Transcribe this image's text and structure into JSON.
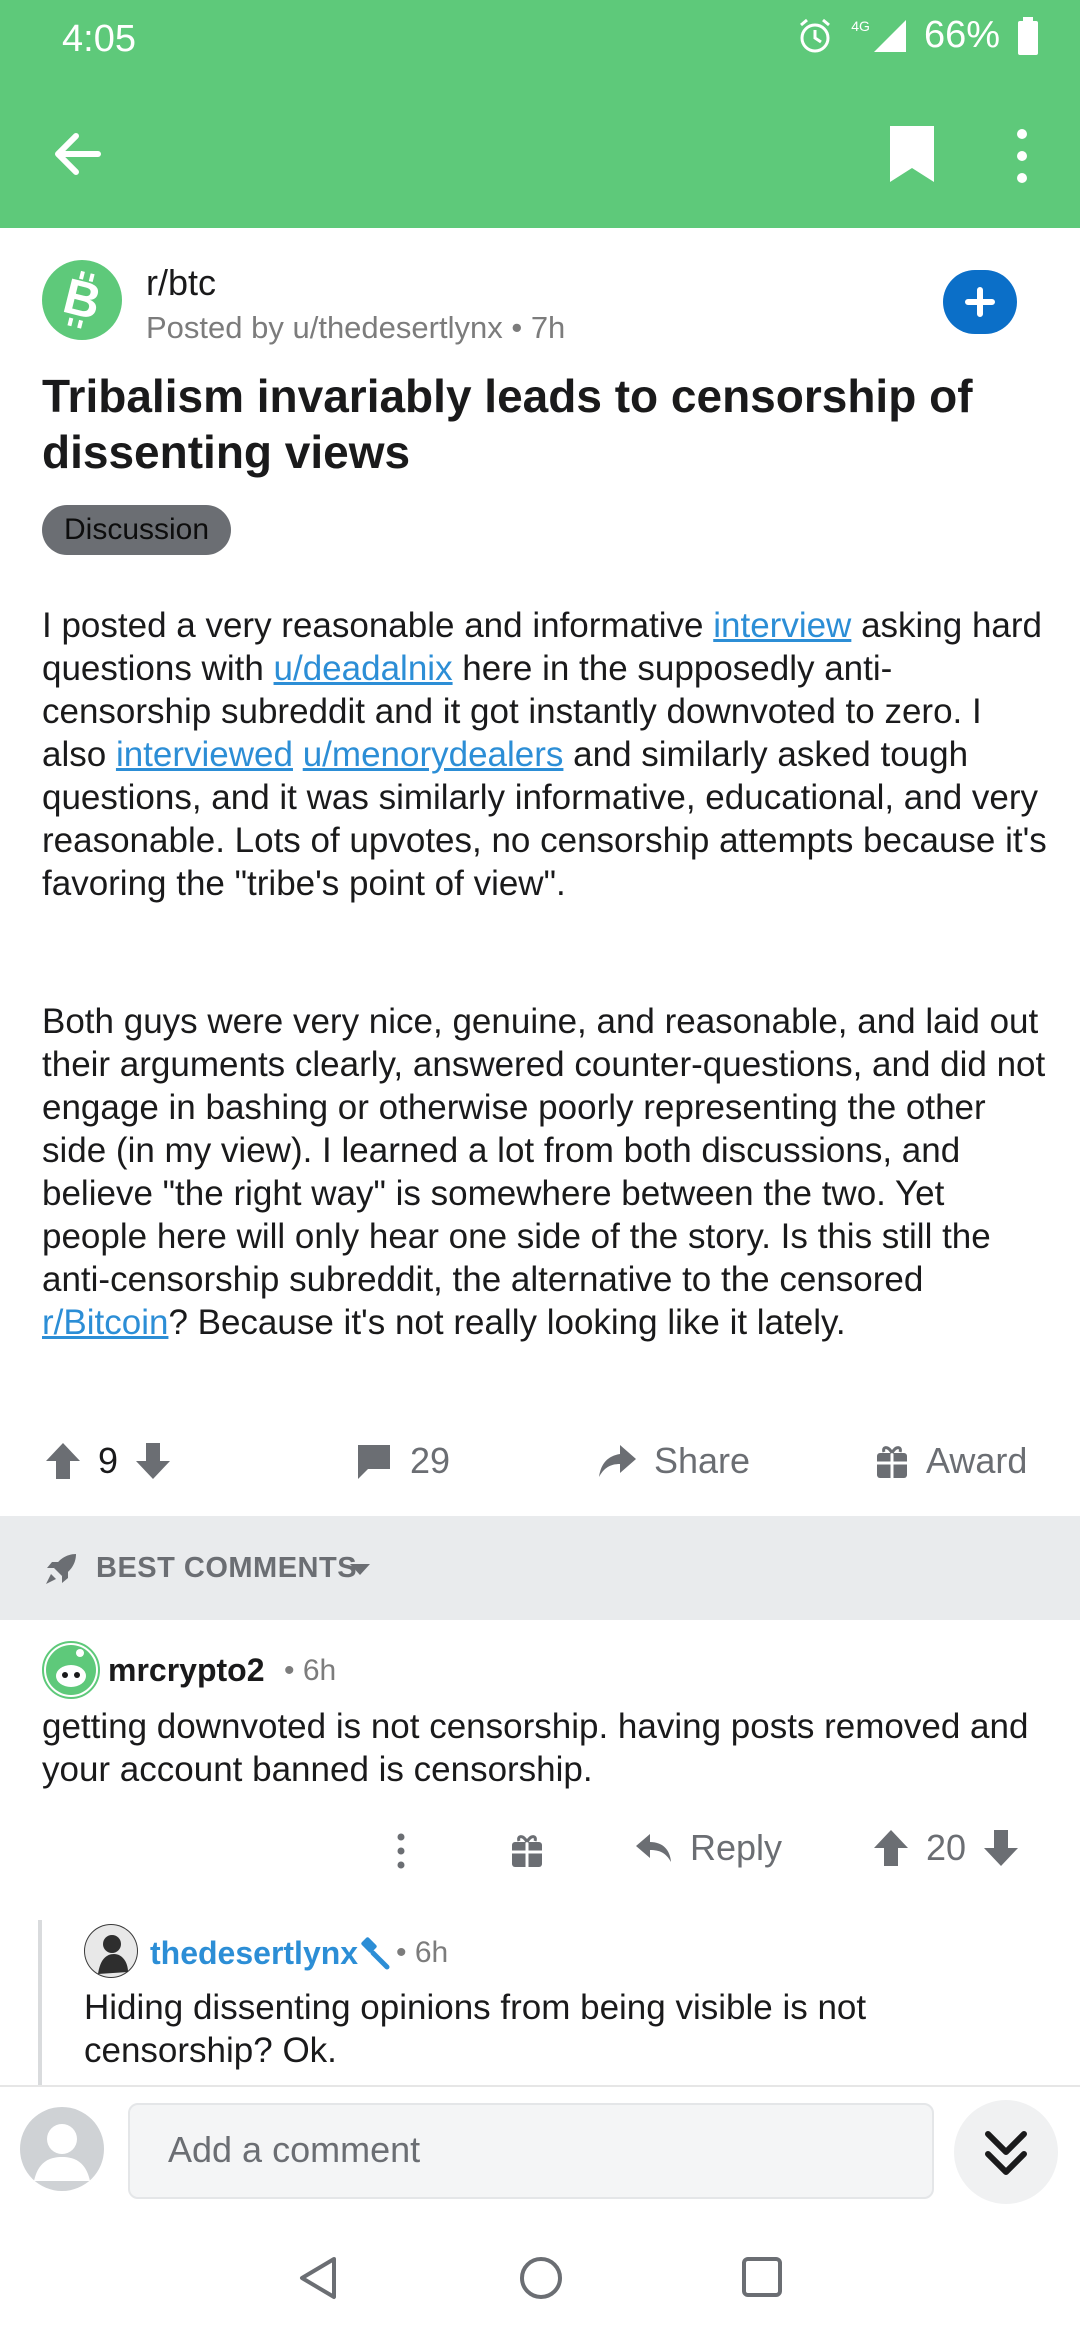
{
  "status_bar": {
    "time": "4:05",
    "battery": "66%",
    "network": "4G"
  },
  "post": {
    "subreddit": "r/btc",
    "posted_by": "Posted by u/thedesertlynx",
    "age": "7h",
    "title": "Tribalism invariably leads to censorship of dissenting views",
    "flair": "Discussion",
    "paragraph1": [
      {
        "t": "I posted a very reasonable and informative "
      },
      {
        "t": "interview",
        "link": true
      },
      {
        "t": " asking hard questions with "
      },
      {
        "t": "u/deadalnix",
        "link": true
      },
      {
        "t": " here in the supposedly anti-censorship subreddit and it got instantly downvoted to zero. I also "
      },
      {
        "t": "interviewed",
        "link": true
      },
      {
        "t": " "
      },
      {
        "t": "u/menorydealers",
        "link": true
      },
      {
        "t": " and similarly asked tough questions, and it was similarly informative, educational, and very reasonable. Lots of upvotes, no censorship attempts because it's favoring the \"tribe's point of view\"."
      }
    ],
    "paragraph2": [
      {
        "t": "Both guys were very nice, genuine, and reasonable, and laid out their arguments clearly, answered counter-questions, and did not engage in bashing or otherwise poorly representing the other side (in my view). I learned a lot from both discussions, and believe \"the right way\" is somewhere between the two. Yet people here will only hear one side of the story. Is this still the anti-censorship subreddit, the alternative to the censored "
      },
      {
        "t": "r/Bitcoin",
        "link": true
      },
      {
        "t": "? Because it's not really looking like it lately."
      }
    ],
    "votes": "9",
    "comments": "29",
    "share_label": "Share",
    "award_label": "Award"
  },
  "sort": {
    "label": "BEST COMMENTS"
  },
  "comments": [
    {
      "author": "mrcrypto2",
      "age": "• 6h",
      "text": "getting downvoted is not censorship.  having posts removed and your account banned is censorship.",
      "reply_label": "Reply",
      "votes": "20"
    },
    {
      "author": "thedesertlynx",
      "age": "• 6h",
      "text": "Hiding dissenting opinions from being visible is not censorship? Ok."
    }
  ],
  "composer": {
    "placeholder": "Add a comment"
  },
  "colors": {
    "header_green": "#5ec97a",
    "link_blue": "#2c8ed6",
    "join_blue": "#0b6fc8"
  }
}
